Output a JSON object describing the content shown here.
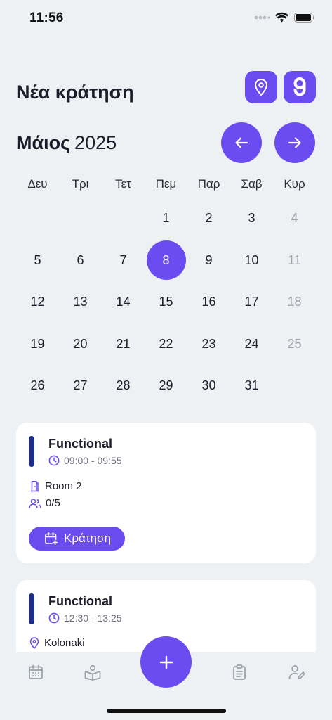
{
  "status_bar": {
    "time": "11:56"
  },
  "header": {
    "title": "Νέα κράτηση"
  },
  "calendar": {
    "month": "Μάιος",
    "year": "2025",
    "weekdays": [
      "Δευ",
      "Τρι",
      "Τετ",
      "Πεμ",
      "Παρ",
      "Σαβ",
      "Κυρ"
    ],
    "days": [
      "",
      "",
      "",
      "1",
      "2",
      "3",
      "4",
      "5",
      "6",
      "7",
      "8",
      "9",
      "10",
      "11",
      "12",
      "13",
      "14",
      "15",
      "16",
      "17",
      "18",
      "19",
      "20",
      "21",
      "22",
      "23",
      "24",
      "25",
      "26",
      "27",
      "28",
      "29",
      "30",
      "31",
      ""
    ],
    "selected_day": "8"
  },
  "classes": [
    {
      "name": "Functional",
      "time": "09:00 - 09:55",
      "room": "Room 2",
      "capacity": "0/5",
      "book_label": "Κράτηση"
    },
    {
      "name": "Functional",
      "time": "12:30 - 13:25",
      "location": "Kolonaki"
    }
  ],
  "bottom_nav": {
    "items": [
      "calendar-icon",
      "reader-icon",
      "add-icon",
      "clipboard-icon",
      "user-edit-icon"
    ]
  },
  "colors": {
    "accent": "#6a4cf0",
    "class_bar": "#1e2c8c",
    "background": "#eef1f4"
  }
}
